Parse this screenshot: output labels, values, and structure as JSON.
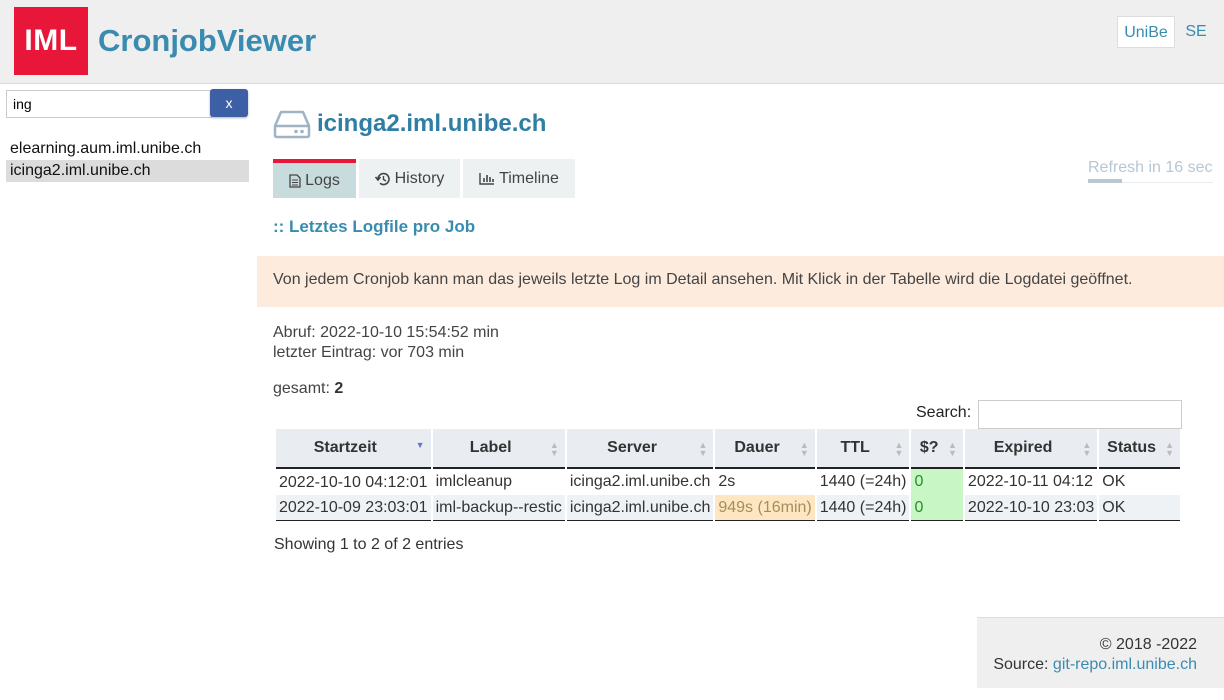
{
  "header": {
    "logo_text": "IML",
    "app_title": "CronjobViewer",
    "lang": [
      "UniBe",
      "SE"
    ]
  },
  "sidebar": {
    "search_value": "ing",
    "clear_label": "x",
    "hosts": [
      "elearning.aum.iml.unibe.ch",
      "icinga2.iml.unibe.ch"
    ],
    "active_host": "icinga2.iml.unibe.ch"
  },
  "main": {
    "host_title": "icinga2.iml.unibe.ch",
    "tabs": [
      {
        "label": "Logs",
        "icon": "file-icon"
      },
      {
        "label": "History",
        "icon": "history-icon"
      },
      {
        "label": "Timeline",
        "icon": "bar-chart-icon"
      }
    ],
    "refresh_text": "Refresh in 16 sec",
    "refresh_progress": 0.27,
    "section_title": ":: Letztes Logfile pro Job",
    "info_text": "Von jedem Cronjob kann man das jeweils letzte Log im Detail ansehen. Mit Klick in der Tabelle wird die Logdatei geöffnet.",
    "abruf": "Abruf: 2022-10-10 15:54:52 min",
    "letzter": "letzter Eintrag: vor 703 min",
    "total_label": "gesamt:",
    "total_value": "2",
    "search_label": "Search:"
  },
  "table": {
    "columns": [
      "Startzeit",
      "Label",
      "Server",
      "Dauer",
      "TTL",
      "$?",
      "Expired",
      "Status"
    ],
    "rows": [
      [
        "2022-10-10 04:12:01",
        "imlcleanup",
        "icinga2.iml.unibe.ch",
        "2s",
        "1440 (=24h)",
        "0",
        "2022-10-11 04:12",
        "OK"
      ],
      [
        "2022-10-09 23:03:01",
        "iml-backup--restic",
        "icinga2.iml.unibe.ch",
        "949s (16min)",
        "1440 (=24h)",
        "0",
        "2022-10-10 23:03",
        "OK"
      ]
    ],
    "showing": "Showing 1 to 2 of 2 entries"
  },
  "footer": {
    "copyright": "© 2018 -2022",
    "source_label": "Source:",
    "source_link": "git-repo.iml.unibe.ch"
  },
  "colors": {
    "brand_red": "#e8173a",
    "link_blue": "#3a8bb0",
    "button_blue": "#3c5fa6",
    "warn_bg": "#fde6c1",
    "ok_bg": "#c8f7c5"
  }
}
